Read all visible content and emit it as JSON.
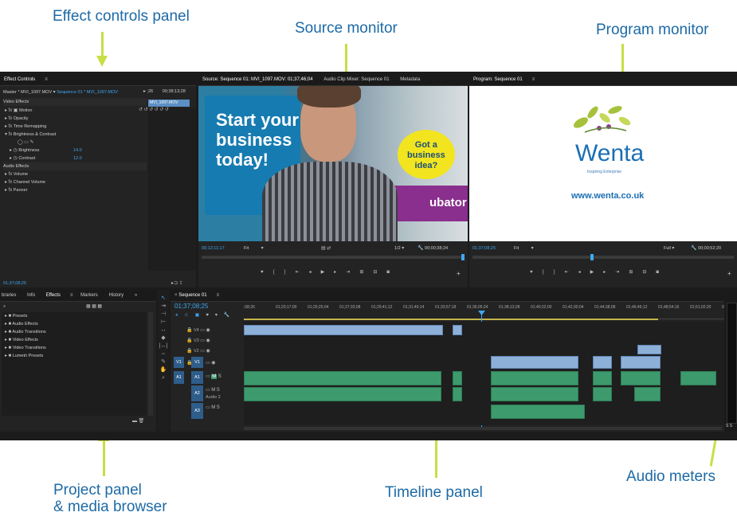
{
  "annotations": {
    "effect_controls": "Effect controls panel",
    "source_monitor": "Source monitor",
    "program_monitor": "Program monitor",
    "project_panel": "Project panel\n& media browser",
    "project_panel_line1": "Project panel",
    "project_panel_line2": "& media browser",
    "timeline_panel": "Timeline panel",
    "audio_meters": "Audio meters"
  },
  "effect_controls": {
    "title": "Effect Controls",
    "master": "Master * MVI_1097.MOV",
    "sequence": "Sequence 01 * MVI_1097.MOV",
    "time_a": ";26",
    "time_b": "00;38;13;28",
    "clip_label": "MVI_1097.MOV",
    "video_effects": "Video Effects",
    "motion": "Motion",
    "opacity": "Opacity",
    "time_remapping": "Time Remapping",
    "brightness_contrast": "Brightness & Contrast",
    "brightness": "Brightness",
    "brightness_val": "14.0",
    "contrast": "Contrast",
    "contrast_val": "12.0",
    "audio_effects": "Audio Effects",
    "volume": "Volume",
    "channel_volume": "Channel Volume",
    "panner": "Panner",
    "timecode": "01;37;08;25"
  },
  "source_monitor": {
    "tab1": "Source: Sequence 01: MVI_1097.MOV: 01;37;46;04",
    "tab2": "Audio Clip Mixer: Sequence 01",
    "tab3": "Metadata",
    "timecode": "00;12;11;17",
    "fit": "Fit",
    "fraction": "1/2",
    "duration": "00;00;38;24",
    "sign_text1": "Start your",
    "sign_text2": "business",
    "sign_text3": "today!",
    "bubble1": "Got a",
    "bubble2": "business",
    "bubble3": "idea?",
    "sign_tail": "ubator"
  },
  "program_monitor": {
    "tab": "Program: Sequence 01",
    "logo": "Wenta",
    "tagline": "Inspiring Enterprise",
    "url": "www.wenta.co.uk",
    "timecode": "01;37;08;25",
    "fit": "Fit",
    "full": "Full",
    "duration": "00;00;52;20"
  },
  "project_panel": {
    "tabs": [
      "braries",
      "Info",
      "Effects",
      "Markers",
      "History"
    ],
    "items": [
      "Presets",
      "Audio Effects",
      "Audio Transitions",
      "Video Effects",
      "Video Transitions",
      "Lumetri Presets"
    ]
  },
  "timeline": {
    "tab": "Sequence 01",
    "timecode": "01;37;08;25",
    "ruler": [
      ";08;26",
      "01;23;17;00",
      "01;25;25;04",
      "01;27;33;08",
      "01;29;41;12",
      "01;31;49;14",
      "01;33;57;18",
      "01;36;05;24",
      "01;38;13;28",
      "01;40;22;00",
      "01;42;30;04",
      "01;44;38;08",
      "01;46;46;12",
      "01;48;54;16",
      "01;51;02;20",
      "01;5"
    ],
    "tracks": {
      "v4": "V4",
      "v3": "V3",
      "v2": "V2",
      "v1": "V1",
      "a1": "A1",
      "a2": "A2",
      "a3": "A3",
      "audio2": "Audio 2",
      "m": "M",
      "s": "S"
    },
    "meter_labels": "S S"
  },
  "colors": {
    "accent": "#3ea7f3",
    "arrow": "#c9de45",
    "annotation": "#1d6aa6",
    "video_clip": "#8db0d9",
    "audio_clip": "#3d9a6c"
  }
}
